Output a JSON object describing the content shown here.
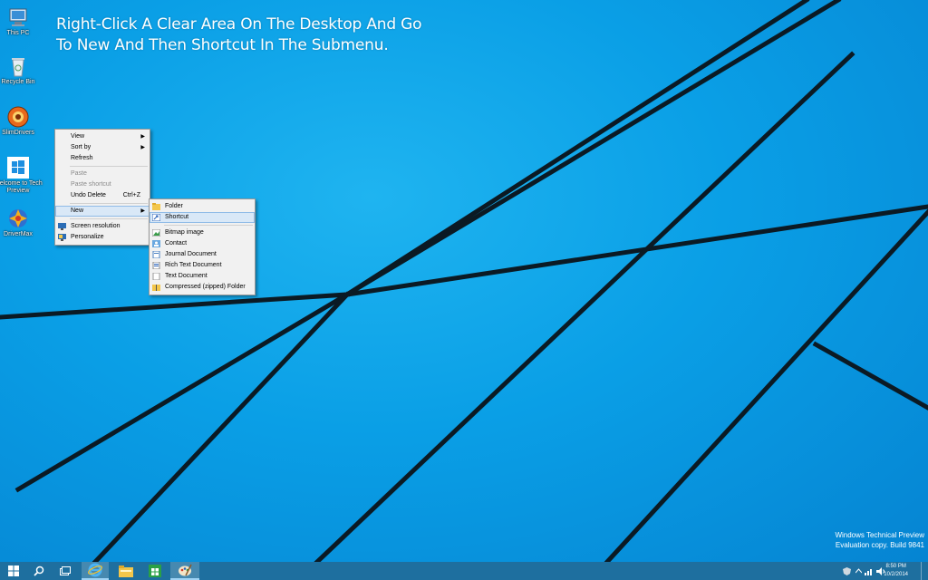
{
  "instruction": {
    "line1": "Right-Click A Clear Area On The Desktop And Go",
    "line2": "To New And Then Shortcut In The Submenu."
  },
  "desktop_icons": [
    {
      "label": "This PC",
      "icon": "computer-icon"
    },
    {
      "label": "Recycle Bin",
      "icon": "recycle-bin-icon"
    },
    {
      "label": "SlimDrivers",
      "icon": "slimdrivers-icon"
    },
    {
      "label": "Welcome to Tech Preview",
      "icon": "windows-logo-icon"
    },
    {
      "label": "DriverMax",
      "icon": "drivermax-icon"
    }
  ],
  "context_menu": {
    "view": "View",
    "sort_by": "Sort by",
    "refresh": "Refresh",
    "paste": "Paste",
    "paste_shortcut": "Paste shortcut",
    "undo_delete": "Undo Delete",
    "undo_shortcut": "Ctrl+Z",
    "new": "New",
    "screen_resolution": "Screen resolution",
    "personalize": "Personalize"
  },
  "submenu": {
    "folder": "Folder",
    "shortcut": "Shortcut",
    "bitmap": "Bitmap image",
    "contact": "Contact",
    "journal": "Journal Document",
    "rtf": "Rich Text Document",
    "text": "Text Document",
    "zip": "Compressed (zipped) Folder"
  },
  "watermark": {
    "line1": "Windows Technical Preview",
    "line2": "Evaluation copy. Build 9841"
  },
  "clock": {
    "time": "8:50 PM",
    "date": "10/2/2014"
  },
  "colors": {
    "wallpaper": "#0a9fe6",
    "taskbar": "#1e6f9f",
    "menu_highlight": "#d9e8f7"
  }
}
